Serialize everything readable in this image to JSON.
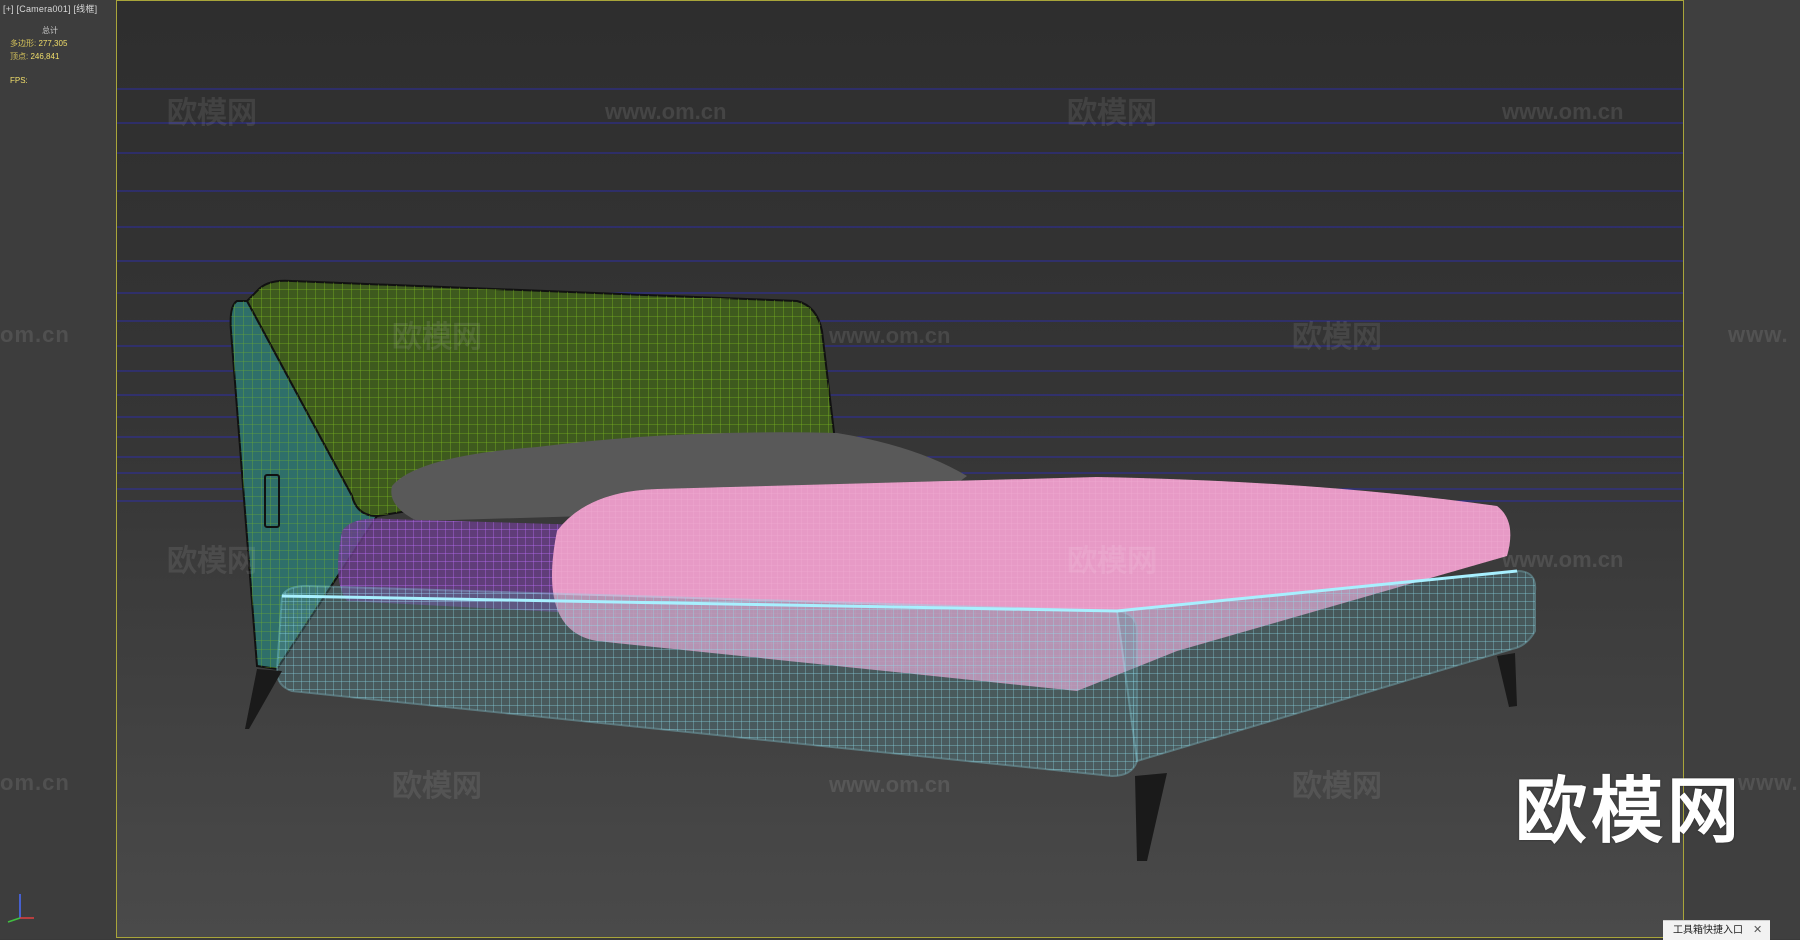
{
  "viewport": {
    "label": "[+] [Camera001] [线框]"
  },
  "stats": {
    "header": "总计",
    "polygons_label": "多边形:",
    "polygons_value": "277,305",
    "vertices_label": "顶点:",
    "vertices_value": "246,841",
    "fps_label": "FPS:"
  },
  "watermarks": {
    "cn": "欧模网",
    "url": "www.om.cn",
    "url_partial_left": "om.cn",
    "url_partial_right": "www."
  },
  "logo": {
    "text": "欧模网"
  },
  "toolbar_entry": {
    "label": "工具箱快捷入口",
    "close_icon": "close-icon"
  },
  "colors": {
    "frame_border": "#a9a53a",
    "headboard": "#7fbf20",
    "frame_wire": "#8ee0ee",
    "duvet": "#e79ac6",
    "mattress_wire": "#c070ff",
    "pillow": "#595959",
    "legs": "#1a1a1a"
  }
}
